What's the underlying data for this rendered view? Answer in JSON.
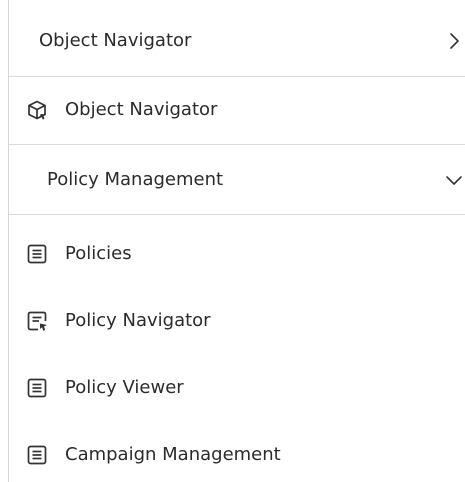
{
  "sections": [
    {
      "header": "Object Navigator",
      "expanded": false,
      "items": [
        {
          "label": "Object Navigator",
          "icon": "cube-icon"
        }
      ]
    },
    {
      "header": "Policy Management",
      "expanded": true,
      "items": [
        {
          "label": "Policies",
          "icon": "document-list-icon"
        },
        {
          "label": "Policy Navigator",
          "icon": "document-navigate-icon"
        },
        {
          "label": "Policy Viewer",
          "icon": "document-list-icon"
        },
        {
          "label": "Campaign Management",
          "icon": "document-list-icon"
        }
      ]
    }
  ]
}
